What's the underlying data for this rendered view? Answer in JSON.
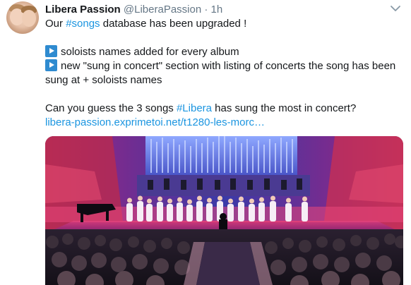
{
  "tweet": {
    "author_name": "Libera Passion",
    "author_handle": "@LiberaPassion",
    "separator": "·",
    "time": "1h",
    "line1_pre": "Our ",
    "line1_hashtag": "#songs",
    "line1_post": " database has been upgraded !",
    "bullet1": "soloists names added for every album",
    "bullet2": "new \"sung in concert\" section with listing of concerts the song has been",
    "bullet2_cont": "sung at + soloists names",
    "line3_pre": "Can you guess the 3 songs ",
    "line3_hashtag": "#Libera",
    "line3_post": " has sung the most in concert?",
    "link": "libera-passion.exprimetoi.net/t1280-les-morc…"
  },
  "icons": {
    "bullet": "play-button-icon",
    "menu": "chevron-down-icon"
  },
  "colors": {
    "link": "#1b95e0",
    "secondary_text": "#657786",
    "primary_text": "#14171a",
    "bullet_icon": "#2f8bd0"
  }
}
